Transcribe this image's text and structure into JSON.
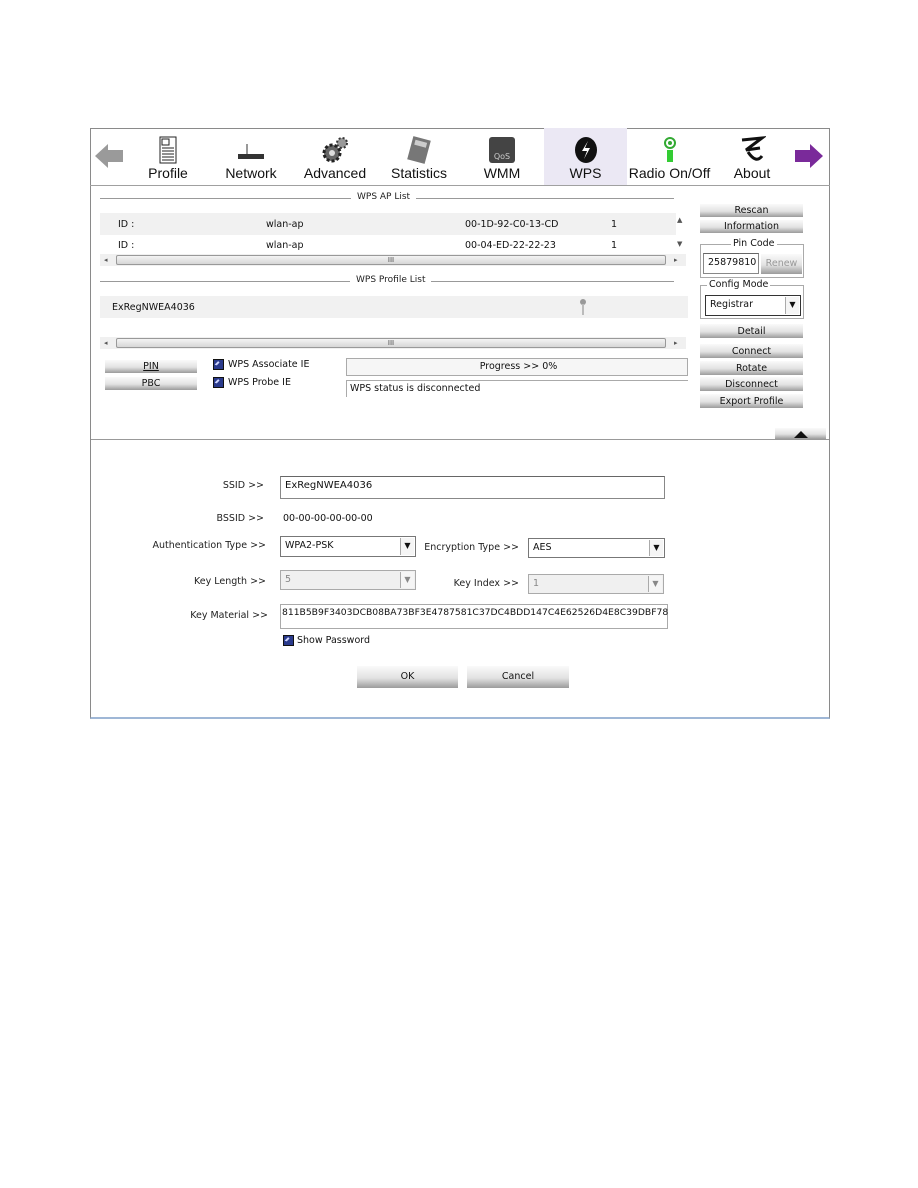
{
  "toolbar": {
    "items": [
      {
        "label": "Profile",
        "icon": "profile-icon"
      },
      {
        "label": "Network",
        "icon": "router-icon"
      },
      {
        "label": "Advanced",
        "icon": "gears-icon"
      },
      {
        "label": "Statistics",
        "icon": "calculator-icon"
      },
      {
        "label": "WMM",
        "icon": "qos-icon"
      },
      {
        "label": "WPS",
        "icon": "wps-icon",
        "active": true
      },
      {
        "label": "Radio On/Off",
        "icon": "radio-icon"
      },
      {
        "label": "About",
        "icon": "about-icon"
      }
    ],
    "back": "back-arrow-icon",
    "forward": "forward-arrow-icon"
  },
  "ap_list": {
    "title": "WPS AP List",
    "rows": [
      {
        "id": "ID :",
        "ssid": "wlan-ap",
        "bssid": "00-1D-92-C0-13-CD",
        "channel": "1"
      },
      {
        "id": "ID :",
        "ssid": "wlan-ap",
        "bssid": "00-04-ED-22-22-23",
        "channel": "1"
      }
    ]
  },
  "profile_list": {
    "title": "WPS Profile List",
    "rows": [
      {
        "name": "ExRegNWEA4036"
      }
    ]
  },
  "side": {
    "rescan": "Rescan",
    "information": "Information",
    "pin_code_label": "Pin Code",
    "pin_code": "25879810",
    "renew": "Renew",
    "config_mode_label": "Config Mode",
    "config_mode": "Registrar",
    "detail": "Detail",
    "connect": "Connect",
    "rotate": "Rotate",
    "disconnect": "Disconnect",
    "export": "Export Profile"
  },
  "actions": {
    "pin": "PIN",
    "pbc": "PBC",
    "associate_ie": "WPS Associate IE",
    "probe_ie": "WPS Probe IE",
    "progress": "Progress >> 0%",
    "progress_value": 0,
    "status": "WPS status is disconnected"
  },
  "form": {
    "ssid_label": "SSID >>",
    "ssid": "ExRegNWEA4036",
    "bssid_label": "BSSID >>",
    "bssid": "00-00-00-00-00-00",
    "auth_label": "Authentication Type >>",
    "auth": "WPA2-PSK",
    "enc_label": "Encryption Type >>",
    "enc": "AES",
    "keylen_label": "Key Length >>",
    "keylen": "5",
    "keyidx_label": "Key Index >>",
    "keyidx": "1",
    "keymat_label": "Key Material >>",
    "keymat": "811B5B9F3403DCB08BA73BF3E4787581C37DC4BDD147C4E62526D4E8C39DBF78",
    "show_password": "Show Password",
    "ok": "OK",
    "cancel": "Cancel"
  }
}
